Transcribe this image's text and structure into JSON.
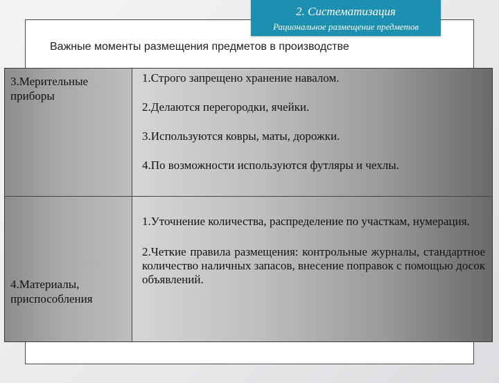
{
  "badge": {
    "title": "2. Систематизация",
    "subtitle": "Рациональное размещение предметов"
  },
  "heading": "Важные моменты размещения предметов в производстве",
  "rows": [
    {
      "label": "3.Мерительные приборы",
      "items": [
        "1.Строго запрещено хранение навалом.",
        "2.Делаются перегородки, ячейки.",
        "3.Используются ковры, маты, дорожки.",
        "4.По возможности используются футляры и чехлы."
      ]
    },
    {
      "label": "4.Материалы, приспособления",
      "items": [
        "1.Уточнение количества, распределение по участкам, нумерация.",
        "2.Четкие правила размещения: контрольные журналы, стандартное количество наличных запасов, внесение поправок с помощью досок объявлений."
      ]
    }
  ],
  "colors": {
    "badge": "#1d8fb0",
    "frame_border": "#4a4a4a"
  }
}
